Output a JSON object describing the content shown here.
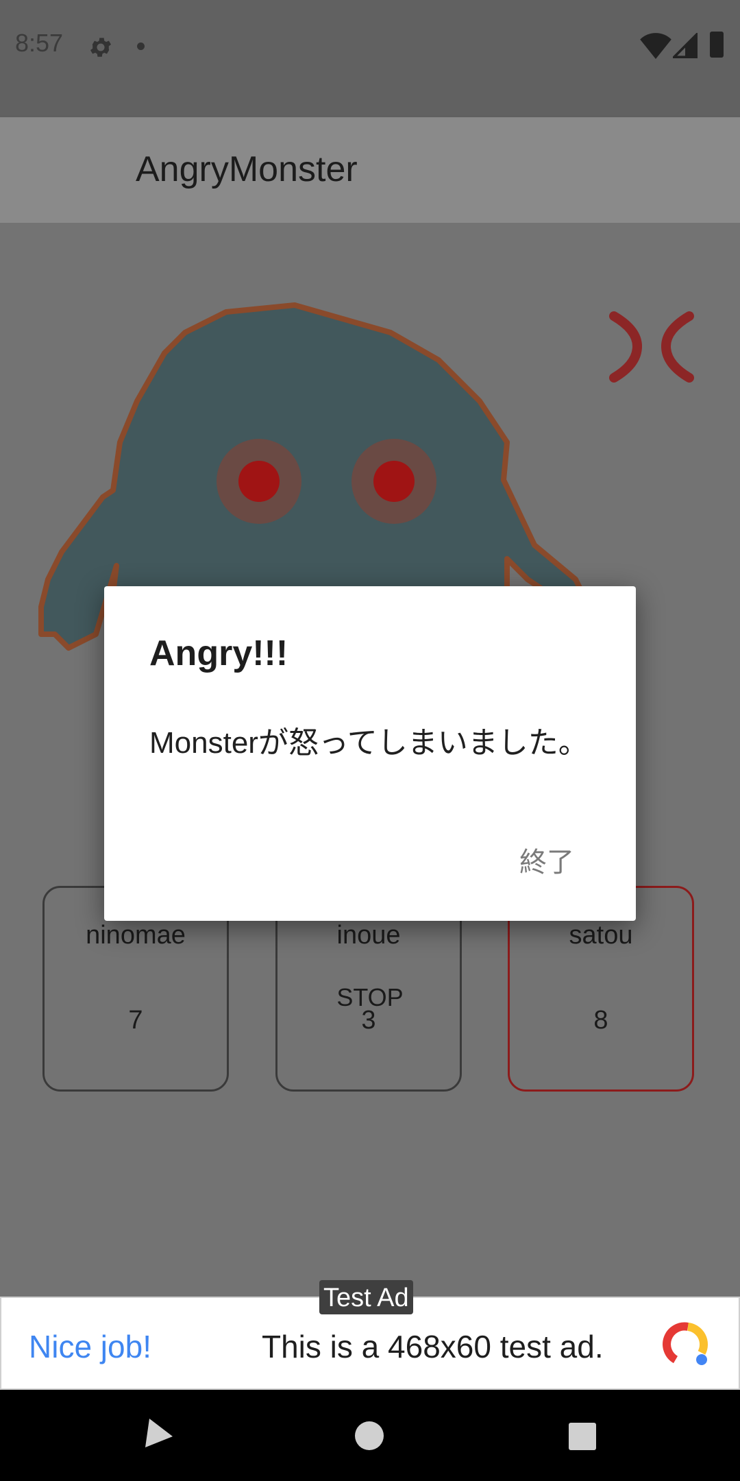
{
  "status_bar": {
    "time": "8:57"
  },
  "app": {
    "title": "AngryMonster"
  },
  "controls": {
    "stop_label": "STOP"
  },
  "players": [
    {
      "name": "ninomae",
      "score": "7",
      "active": false
    },
    {
      "name": "inoue",
      "score": "3",
      "active": false
    },
    {
      "name": "satou",
      "score": "8",
      "active": true
    }
  ],
  "dialog": {
    "title": "Angry!!!",
    "message": "Monsterが怒ってしまいました。",
    "ok_label": "終了"
  },
  "ad": {
    "label": "Test Ad",
    "headline": "Nice job!",
    "text": "This is a 468x60 test ad."
  },
  "colors": {
    "monster_body": "#42585c",
    "monster_outline": "#8a4a2b",
    "eye_red": "#a01414",
    "anger_mark": "#8c2626",
    "ad_headline": "#3f86f1"
  },
  "icons": [
    "settings-icon",
    "notification-dot-icon",
    "wifi-icon",
    "signal-icon",
    "battery-icon",
    "anger-mark-icon",
    "adchoices-icon",
    "nav-back-icon",
    "nav-home-icon",
    "nav-recents-icon"
  ]
}
